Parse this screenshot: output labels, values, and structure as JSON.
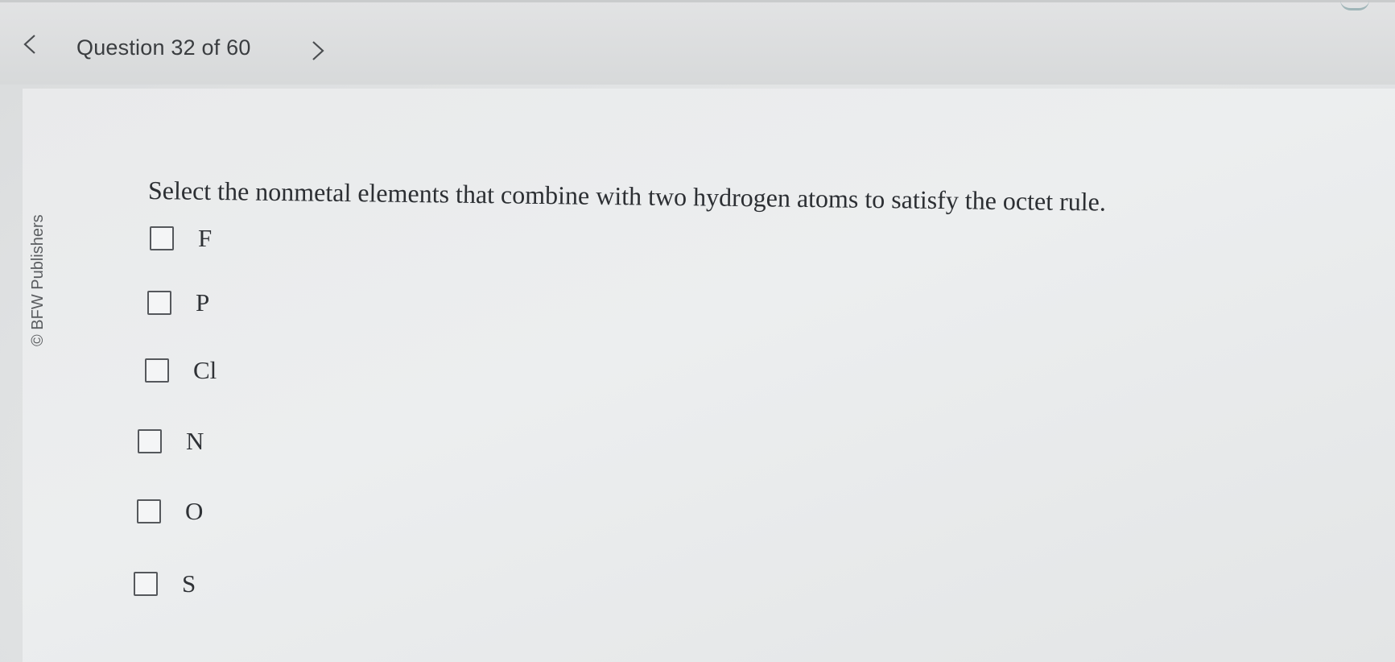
{
  "header": {
    "question_counter": "Question 32 of 60",
    "prev_icon": "chevron-left-icon",
    "next_icon": "chevron-right-icon"
  },
  "sidebar": {
    "copyright": "© BFW Publishers"
  },
  "question": {
    "prompt": "Select the nonmetal elements that combine with two hydrogen atoms to satisfy the octet rule.",
    "options": [
      {
        "label": "F",
        "checked": false
      },
      {
        "label": "P",
        "checked": false
      },
      {
        "label": "Cl",
        "checked": false
      },
      {
        "label": "N",
        "checked": false
      },
      {
        "label": "O",
        "checked": false
      },
      {
        "label": "S",
        "checked": false
      }
    ]
  }
}
